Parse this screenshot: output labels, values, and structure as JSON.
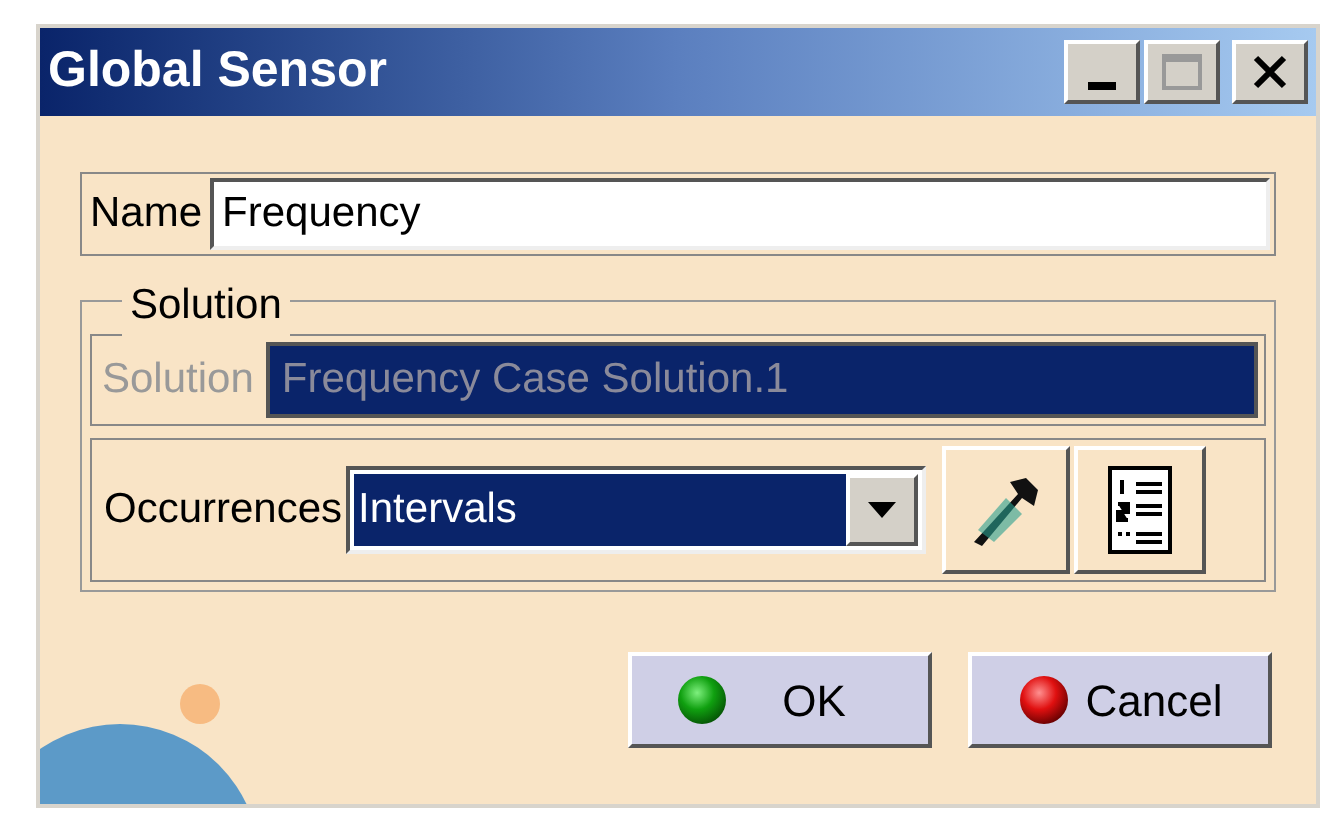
{
  "window": {
    "title": "Global Sensor"
  },
  "name_field": {
    "label": "Name",
    "value": "Frequency"
  },
  "solution_group": {
    "title": "Solution",
    "label": "Solution",
    "value": "Frequency Case Solution.1",
    "disabled": true
  },
  "occurrences": {
    "label": "Occurrences",
    "value": "Intervals",
    "selected": true
  },
  "buttons": [
    {
      "label": "OK",
      "kind": "ok"
    },
    {
      "label": "Cancel",
      "kind": "cancel"
    }
  ]
}
